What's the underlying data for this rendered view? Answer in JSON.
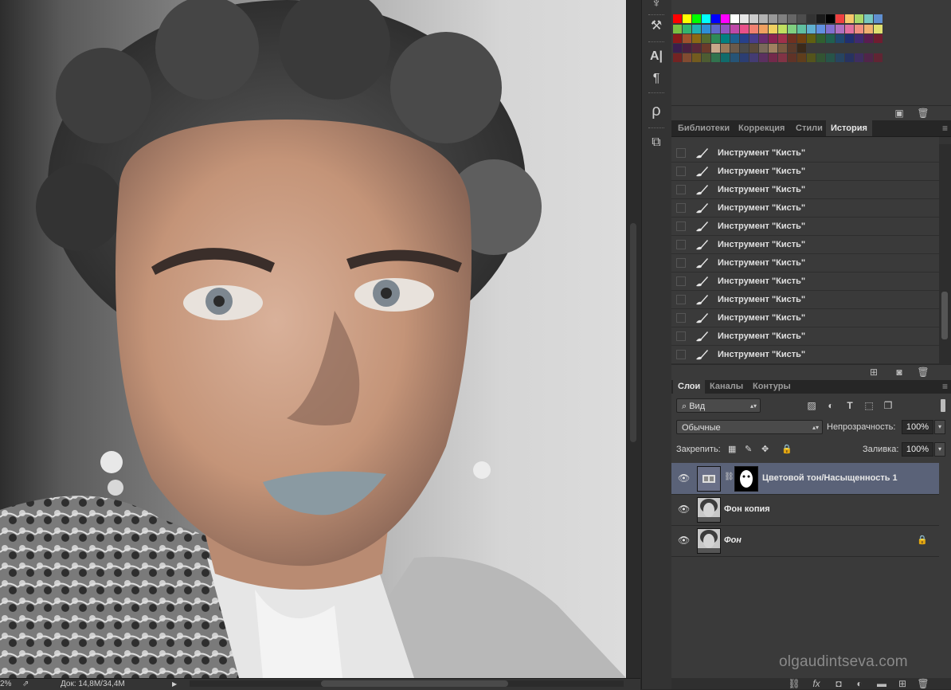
{
  "statusbar": {
    "zoom": "2%",
    "doc_info": "Док: 14,8M/34,4M"
  },
  "colors": {
    "accent_selected": "#5a6278",
    "panel_bg": "#3a3a3a",
    "tab_bg": "#262626"
  },
  "swatch_rows": [
    [
      "#ff0000",
      "#ffff00",
      "#00ff00",
      "#00ffff",
      "#0000ff",
      "#ff00ff",
      "#ffffff",
      "#e6e6e6",
      "#cccccc",
      "#b3b3b3",
      "#999999",
      "#808080",
      "#666666",
      "#4d4d4d",
      "#333333",
      "#1a1a1a",
      "#000000",
      "#ee4040",
      "#f6c66a",
      "#a8d76a",
      "#76c7c0",
      "#5f8fd0"
    ],
    [
      "#79c043",
      "#33b46e",
      "#20b0b0",
      "#2e8fd6",
      "#5f69c8",
      "#8f55c0",
      "#c048a8",
      "#e8508a",
      "#f08070",
      "#f0a060",
      "#f0d060",
      "#c0e060",
      "#80d080",
      "#60c0a0",
      "#60b0d0",
      "#6090e0",
      "#8070d0",
      "#b070c0",
      "#e070a0",
      "#f09080",
      "#f0b070",
      "#e0e070"
    ],
    [
      "#8b1a1a",
      "#a0522d",
      "#8b6914",
      "#556b2f",
      "#2e8b57",
      "#008080",
      "#1e6090",
      "#27408b",
      "#483d8b",
      "#6a2c70",
      "#8b2252",
      "#a0304a",
      "#703020",
      "#704010",
      "#606010",
      "#306030",
      "#206050",
      "#204870",
      "#202f70",
      "#402a70",
      "#5a1d50",
      "#701d30"
    ],
    [
      "#3a1e4e",
      "#4a2040",
      "#5a2838",
      "#6b3a2a",
      "#c8a88a",
      "#9a7a5a",
      "#6a5a4a",
      "#4a4a4a",
      "#5a4a3a",
      "#7a6a5a",
      "#a08060",
      "#7a5a40",
      "#5a3a2a",
      "#3a2a1a"
    ]
  ],
  "history": {
    "tabs": [
      "Библиотеки",
      "Коррекция",
      "Стили",
      "История"
    ],
    "active_tab": "История",
    "items": [
      "Инструмент \"Кисть\"",
      "Инструмент \"Кисть\"",
      "Инструмент \"Кисть\"",
      "Инструмент \"Кисть\"",
      "Инструмент \"Кисть\"",
      "Инструмент \"Кисть\"",
      "Инструмент \"Кисть\"",
      "Инструмент \"Кисть\"",
      "Инструмент \"Кисть\"",
      "Инструмент \"Кисть\"",
      "Инструмент \"Кисть\"",
      "Инструмент \"Кисть\""
    ]
  },
  "layers_panel": {
    "tabs": [
      "Слои",
      "Каналы",
      "Контуры"
    ],
    "active_tab": "Слои",
    "filter_label": "Вид",
    "blend_mode": "Обычные",
    "opacity_label": "Непрозрачность:",
    "opacity_value": "100%",
    "lock_label": "Закрепить:",
    "fill_label": "Заливка:",
    "fill_value": "100%",
    "layers": [
      {
        "name": "Цветовой тон/Насыщенность 1",
        "selected": true,
        "italic": false,
        "type": "adjustment"
      },
      {
        "name": "Фон копия",
        "selected": false,
        "italic": false,
        "type": "photo"
      },
      {
        "name": "Фон",
        "selected": false,
        "italic": true,
        "type": "photo",
        "locked": true
      }
    ]
  },
  "toolstrip_icons": [
    "brush-presets-icon",
    "clone-source-icon",
    "character-icon",
    "paragraph-icon",
    "glyph-icon",
    "3d-icon"
  ],
  "watermark": "olgaudintseva.com"
}
